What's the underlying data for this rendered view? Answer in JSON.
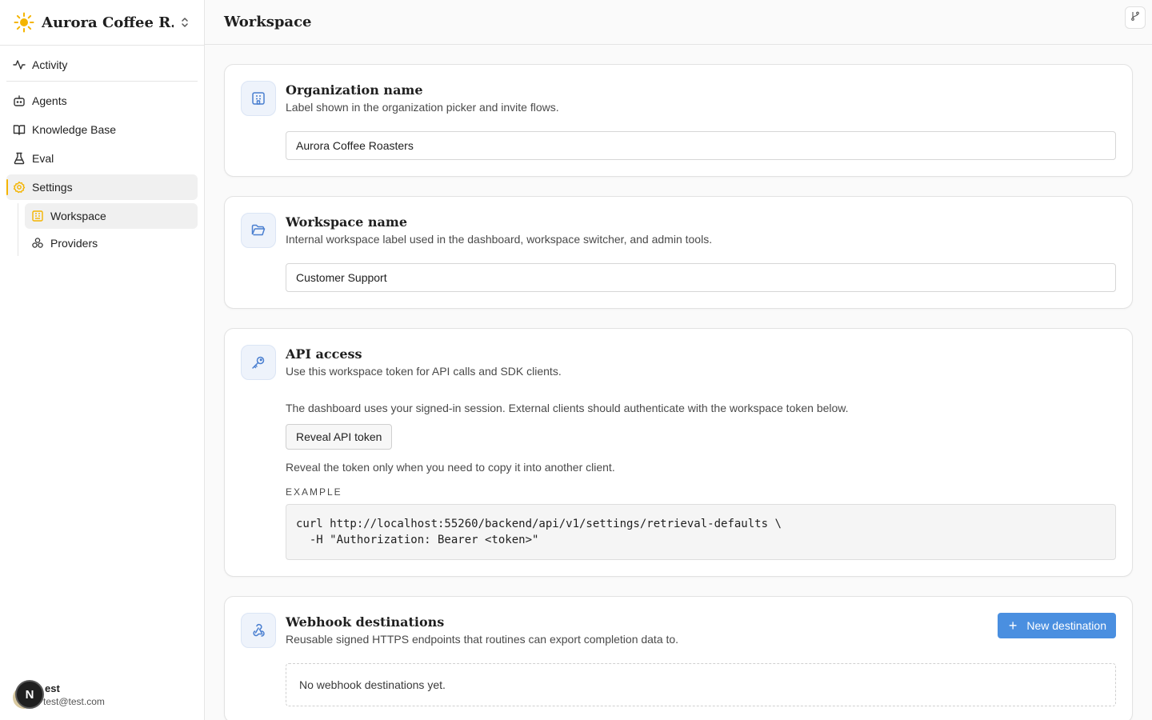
{
  "org": {
    "name": "Aurora Coffee R..."
  },
  "nav": {
    "activity": "Activity",
    "agents": "Agents",
    "knowledge_base": "Knowledge Base",
    "eval": "Eval",
    "settings": "Settings",
    "workspace": "Workspace",
    "providers": "Providers"
  },
  "user": {
    "initial": "N",
    "name": "est",
    "email": "test@test.com"
  },
  "header": {
    "title": "Workspace"
  },
  "org_card": {
    "title": "Organization name",
    "desc": "Label shown in the organization picker and invite flows.",
    "value": "Aurora Coffee Roasters"
  },
  "workspace_card": {
    "title": "Workspace name",
    "desc": "Internal workspace label used in the dashboard, workspace switcher, and admin tools.",
    "value": "Customer Support"
  },
  "api_card": {
    "title": "API access",
    "desc": "Use this workspace token for API calls and SDK clients.",
    "session_note": "The dashboard uses your signed-in session. External clients should authenticate with the workspace token below.",
    "reveal_label": "Reveal API token",
    "hint": "Reveal the token only when you need to copy it into another client.",
    "example_label": "EXAMPLE",
    "example_code": "curl http://localhost:55260/backend/api/v1/settings/retrieval-defaults \\\n  -H \"Authorization: Bearer <token>\""
  },
  "webhook_card": {
    "title": "Webhook destinations",
    "desc": "Reusable signed HTTPS endpoints that routines can export completion data to.",
    "new_label": "New destination",
    "empty": "No webhook destinations yet."
  },
  "colors": {
    "accent": "#4a8fe0",
    "active_marker": "#f4b400",
    "icon_blue": "#4a7fd0"
  }
}
